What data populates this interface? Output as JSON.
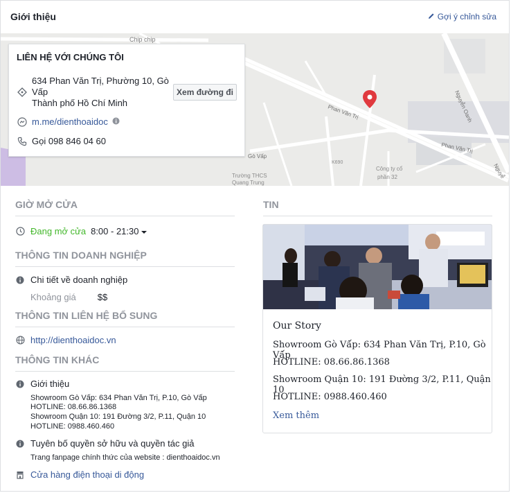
{
  "header": {
    "title": "Giới thiệu",
    "suggest_edit": "Gợi ý chỉnh sửa"
  },
  "map": {
    "labels": {
      "chip_chip": "Chip chip",
      "phan_van_tri_1": "Phan Văn Trị",
      "phan_van_tri_2": "Phan Văn Trị",
      "nguyen_oanh": "Nguyễn Oanh",
      "go_vap": "Gò Vấp",
      "k690": "K690",
      "truong_thcs": "Trường THCS",
      "quang_trung": "Quang Trung",
      "cong_ty": "Công ty cổ",
      "phan32": "phần 32",
      "nguyen_short": "Nguyễ"
    },
    "pin_color": "#e0393e"
  },
  "contact": {
    "title": "LIÊN HỆ VỚI CHÚNG TÔI",
    "address_line1": "634 Phan Văn Trị, Phường 10, Gò Vấp",
    "address_line2": "Thành phố Hồ Chí Minh",
    "directions": "Xem đường đi",
    "messenger": "m.me/dienthoaidoc",
    "phone": "Gọi 098 846 04 60"
  },
  "hours": {
    "heading": "GIỜ MỞ CỬA",
    "status": "Đang mở cửa",
    "time": "8:00 - 21:30"
  },
  "business": {
    "heading": "THÔNG TIN DOANH NGHIỆP",
    "details": "Chi tiết về doanh nghiệp",
    "price_label": "Khoảng giá",
    "price_value": "$$"
  },
  "extra_contact": {
    "heading": "THÔNG TIN LIÊN HỆ BỔ SUNG",
    "website": "http://dienthoaidoc.vn"
  },
  "other": {
    "heading": "THÔNG TIN KHÁC",
    "about_label": "Giới thiệu",
    "about_lines": [
      "Showroom Gò Vấp: 634 Phan Văn Trị, P.10, Gò Vấp",
      "HOTLINE: 08.66.86.1368",
      "Showroom Quận 10: 191 Đường 3/2, P.11, Quận 10",
      "HOTLINE: 0988.460.460"
    ],
    "copyright_label": "Tuyên bố quyền sở hữu và quyền tác giả",
    "copyright_text": "Trang fanpage chính thức của website : dienthoaidoc.vn",
    "category": "Cửa hàng điện thoại di động"
  },
  "news": {
    "heading": "TIN",
    "title": "Our Story",
    "lines": [
      "Showroom Gò Vấ́p: 634 Phan Văn Trị, P.10, Gò Vấ́p",
      "HOTLINE: 08.66.86.1368",
      "Showroom Quận 10: 191 Đường 3/2, P.11, Quận 10",
      "HOTLINE: 0988.460.460"
    ],
    "see_more": "Xem thêm"
  }
}
